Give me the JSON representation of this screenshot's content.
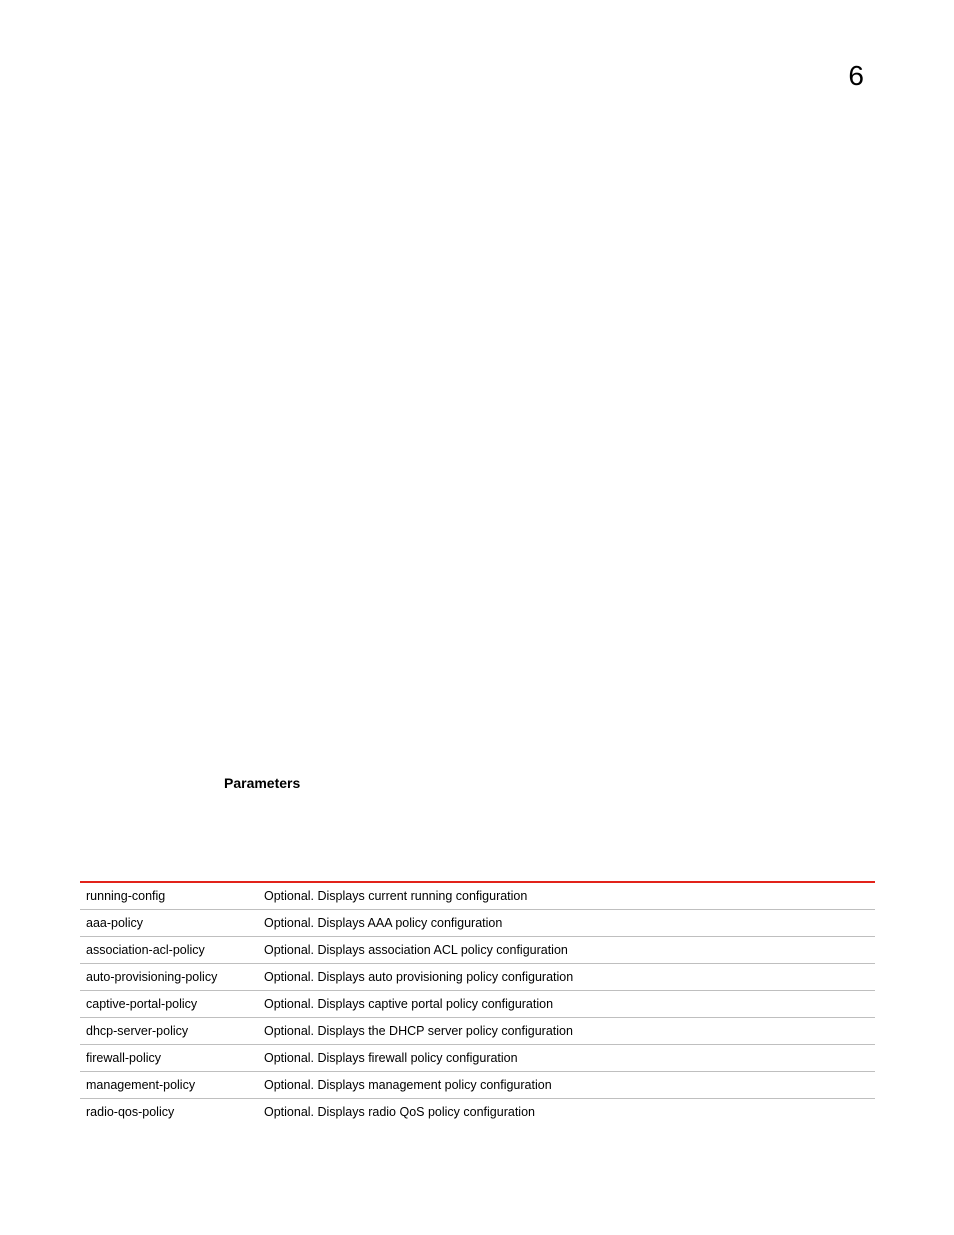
{
  "page_number": "6",
  "section_heading": "Parameters",
  "table": {
    "rows": [
      {
        "param": "running-config",
        "desc": "Optional. Displays current running configuration"
      },
      {
        "param": "aaa-policy",
        "desc": "Optional. Displays AAA policy configuration"
      },
      {
        "param": "association-acl-policy",
        "desc": "Optional. Displays association ACL policy configuration"
      },
      {
        "param": "auto-provisioning-policy",
        "desc": "Optional. Displays auto provisioning policy configuration"
      },
      {
        "param": "captive-portal-policy",
        "desc": "Optional. Displays captive portal policy configuration"
      },
      {
        "param": "dhcp-server-policy",
        "desc": "Optional. Displays the DHCP server policy configuration"
      },
      {
        "param": "firewall-policy",
        "desc": "Optional. Displays firewall policy configuration"
      },
      {
        "param": "management-policy",
        "desc": "Optional. Displays management policy configuration"
      },
      {
        "param": "radio-qos-policy",
        "desc": "Optional. Displays radio QoS policy configuration"
      }
    ]
  }
}
